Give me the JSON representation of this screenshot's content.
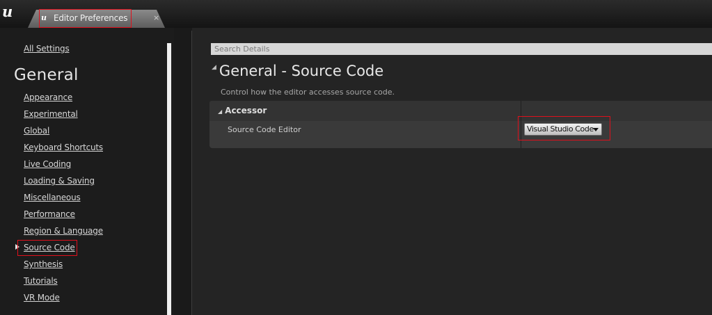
{
  "window": {
    "tab_title": "Editor Preferences",
    "close_glyph": "×",
    "app_logo_icon": "unreal-logo-icon"
  },
  "sidebar": {
    "all_settings": "All Settings",
    "section_title": "General",
    "items": [
      {
        "label": "Appearance"
      },
      {
        "label": "Experimental"
      },
      {
        "label": "Global"
      },
      {
        "label": "Keyboard Shortcuts"
      },
      {
        "label": "Live Coding"
      },
      {
        "label": "Loading & Saving"
      },
      {
        "label": "Miscellaneous"
      },
      {
        "label": "Performance"
      },
      {
        "label": "Region & Language"
      },
      {
        "label": "Source Code",
        "selected": true
      },
      {
        "label": "Synthesis"
      },
      {
        "label": "Tutorials"
      },
      {
        "label": "VR Mode"
      }
    ]
  },
  "details": {
    "search_placeholder": "Search Details",
    "heading": "General - Source Code",
    "description": "Control how the editor accesses source code.",
    "category": "Accessor",
    "property_name": "Source Code Editor",
    "property_value": "Visual Studio Code"
  },
  "colors": {
    "highlight": "#e0101c",
    "background": "#1a1a1a"
  }
}
